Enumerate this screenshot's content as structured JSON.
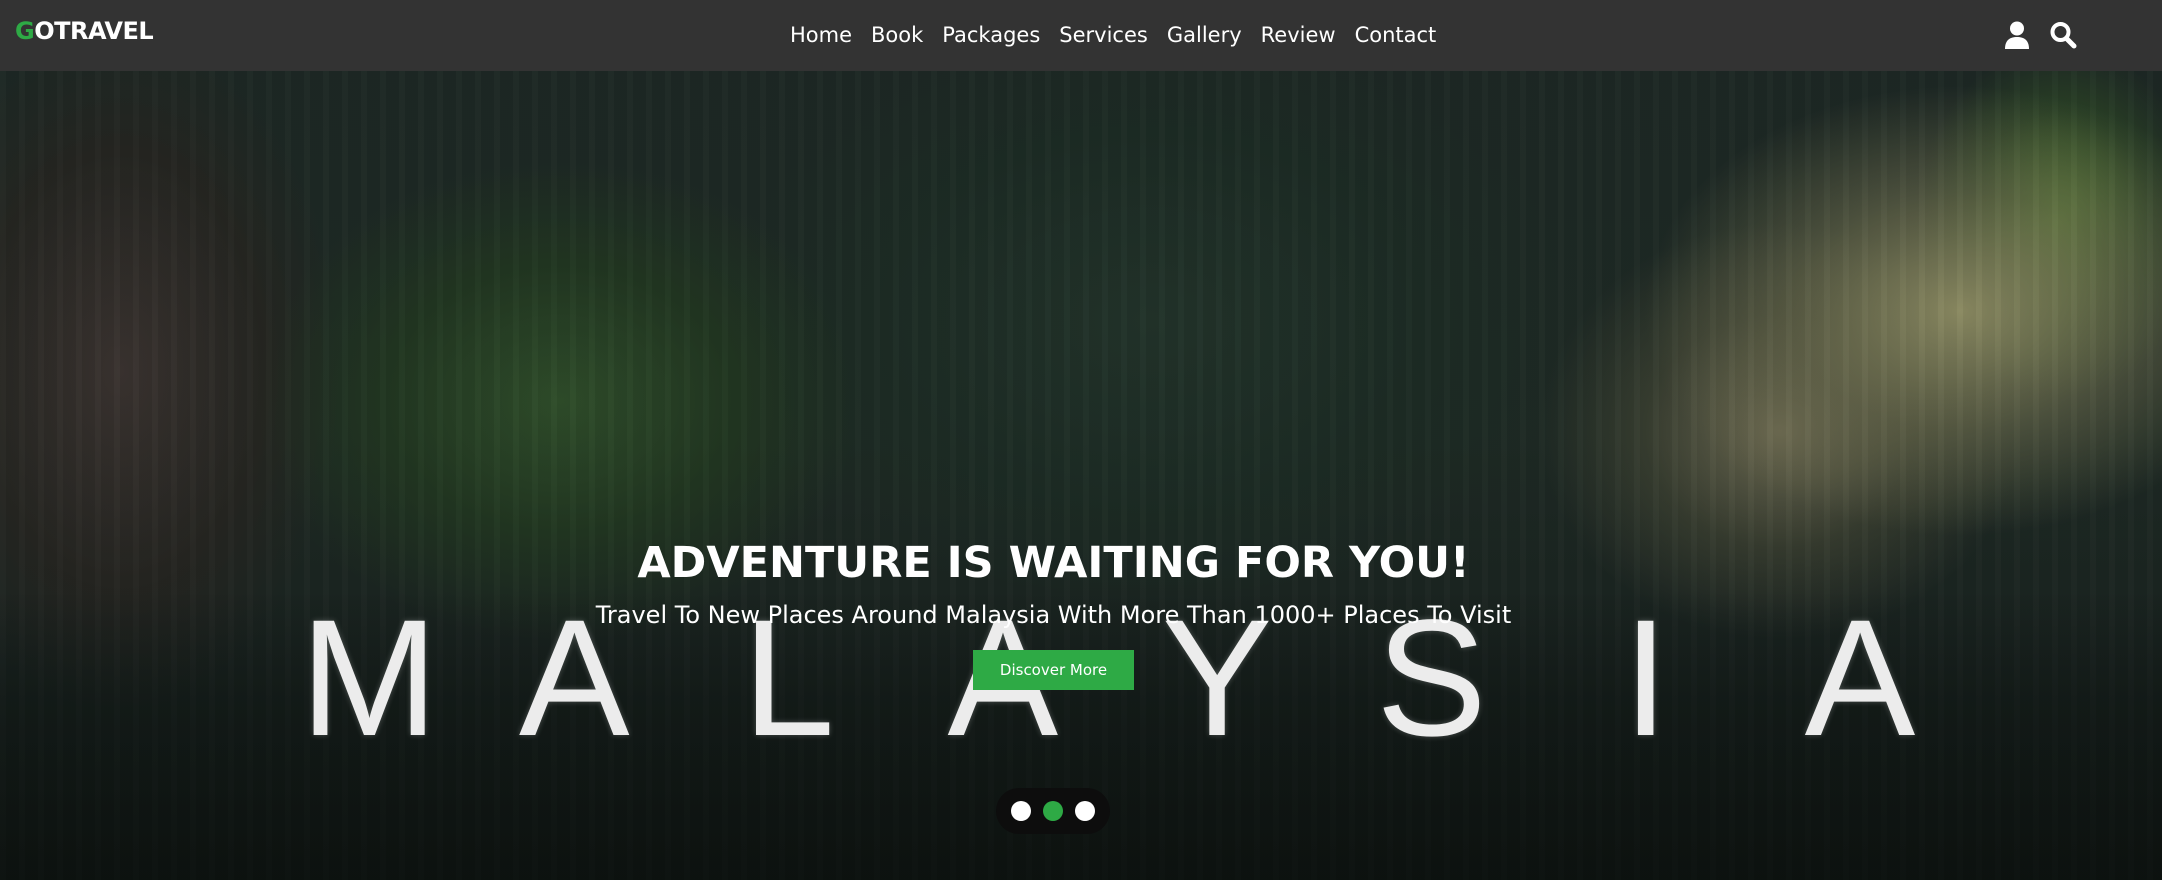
{
  "brand": {
    "logo_first": "G",
    "logo_rest": "OTRAVEL",
    "accent": "#2eaa45"
  },
  "nav": {
    "items": [
      {
        "label": "Home"
      },
      {
        "label": "Book"
      },
      {
        "label": "Packages"
      },
      {
        "label": "Services"
      },
      {
        "label": "Gallery"
      },
      {
        "label": "Review"
      },
      {
        "label": "Contact"
      }
    ]
  },
  "header_icons": {
    "user": "user-icon",
    "search": "search-icon"
  },
  "hero": {
    "title": "ADVENTURE IS WAITING FOR YOU!",
    "subtitle": "Travel To New Places Around Malaysia With More Than 1000+ Places To Visit",
    "cta_label": "Discover More",
    "video_text": [
      "M",
      "A",
      "L",
      "A",
      "Y",
      "S",
      "I",
      "A"
    ]
  },
  "slider": {
    "count": 3,
    "active_index": 1
  },
  "colors": {
    "header_bg": "#333333",
    "button_bg": "#2eaa45",
    "dot_active": "#2eaa45",
    "dot": "#ffffff"
  }
}
